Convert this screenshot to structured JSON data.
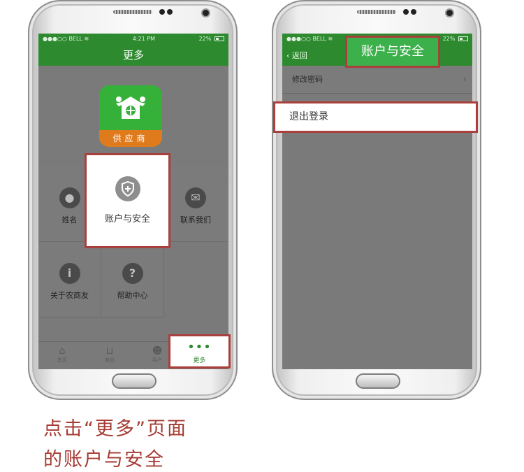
{
  "left_phone": {
    "status": {
      "carrier": "●●●○○ BELL ≋",
      "time": "4:21 PM",
      "battery": "22%"
    },
    "nav_title": "更多",
    "logo_text": "供应商",
    "grid": [
      {
        "label": "姓名",
        "icon": "person-icon"
      },
      {
        "label": "账户与安全",
        "icon": "shield-icon"
      },
      {
        "label": "联系我们",
        "icon": "mail-icon"
      },
      {
        "label": "关于农商友",
        "icon": "info-icon"
      },
      {
        "label": "帮助中心",
        "icon": "help-icon"
      }
    ],
    "tabs": [
      {
        "label": "首页",
        "icon": "shop-icon"
      },
      {
        "label": "商品",
        "icon": "basket-icon"
      },
      {
        "label": "客户",
        "icon": "users-icon"
      },
      {
        "label": "更多",
        "icon": "more-dots-icon"
      }
    ],
    "popup_account": "账户与安全",
    "popup_more_dots": "•••",
    "popup_more": "更多"
  },
  "right_phone": {
    "status": {
      "carrier": "●●●○○ BELL ≋",
      "battery": "22%"
    },
    "back_label": "返回",
    "nav_title": "账户与安全",
    "rows": [
      {
        "label": "修改密码"
      },
      {
        "label": "退出登录"
      }
    ]
  },
  "caption": {
    "line1": "点击“更多”页面",
    "line2": "的账户与安全"
  },
  "colors": {
    "green": "#2e8a2f",
    "highlight_border": "#a9403b",
    "caption": "#a53b33"
  }
}
